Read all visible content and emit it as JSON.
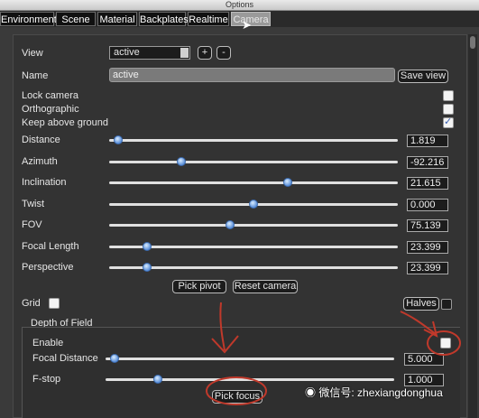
{
  "window": {
    "title": "Options"
  },
  "tabs": [
    {
      "label": "Environment"
    },
    {
      "label": "Scene"
    },
    {
      "label": "Material"
    },
    {
      "label": "Backplates"
    },
    {
      "label": "Realtime"
    },
    {
      "label": "Camera"
    }
  ],
  "camera": {
    "view_label": "View",
    "view_value": "active",
    "add_label": "+",
    "remove_label": "-",
    "name_label": "Name",
    "name_value": "active",
    "save_view_label": "Save view",
    "lock_camera_label": "Lock camera",
    "lock_camera_checked": false,
    "orthographic_label": "Orthographic",
    "orthographic_checked": false,
    "keep_above_ground_label": "Keep above ground",
    "keep_above_ground_checked": true,
    "sliders": [
      {
        "label": "Distance",
        "value": "1.819",
        "fraction": 0.03
      },
      {
        "label": "Azimuth",
        "value": "-92.216",
        "fraction": 0.25
      },
      {
        "label": "Inclination",
        "value": "21.615",
        "fraction": 0.62
      },
      {
        "label": "Twist",
        "value": "0.000",
        "fraction": 0.5
      },
      {
        "label": "FOV",
        "value": "75.139",
        "fraction": 0.42
      },
      {
        "label": "Focal Length",
        "value": "23.399",
        "fraction": 0.13
      },
      {
        "label": "Perspective",
        "value": "23.399",
        "fraction": 0.13
      }
    ],
    "pick_pivot_label": "Pick pivot",
    "reset_camera_label": "Reset camera",
    "grid_label": "Grid",
    "grid_checked": false,
    "halves_label": "Halves"
  },
  "dof": {
    "title": "Depth of Field",
    "enable_label": "Enable",
    "enable_checked": false,
    "sliders": [
      {
        "label": "Focal Distance",
        "value": "5.000",
        "fraction": 0.03
      },
      {
        "label": "F-stop",
        "value": "1.000",
        "fraction": 0.18
      }
    ],
    "pick_focus_label": "Pick focus"
  },
  "watermark": {
    "text": "微信号: zhexiangdonghua"
  },
  "colors": {
    "slider_knob": "#5b8fd8",
    "annotation": "#c0392b"
  }
}
